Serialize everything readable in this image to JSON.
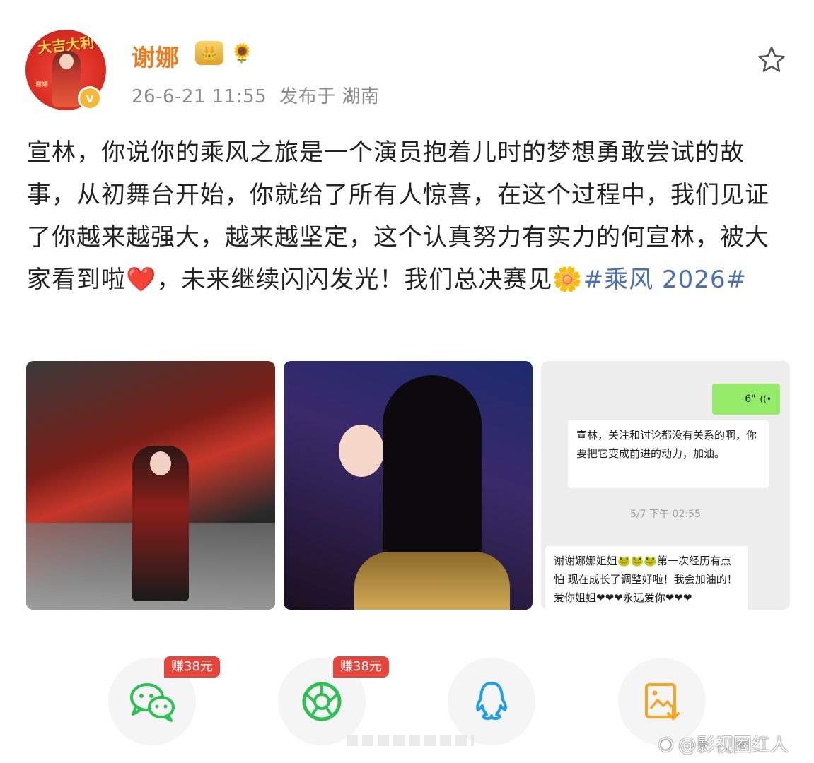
{
  "post": {
    "author": "谢娜",
    "verified_mark": "v",
    "avatar_caption": "大吉大利",
    "avatar_seal": "谢娜",
    "date": "26-6-21 11:55",
    "location": "发布于 湖南",
    "text_part1": "宣林，你说你的乘风之旅是一个演员抱着儿时的梦想勇敢尝试的故事，从初舞台开始，你就给了所有人惊喜，在这个过程中，我们见证了你越来越强大，越来越坚定，这个认真努力有实力的何宣林，被大家看到啦",
    "heart_emoji": "❤️",
    "text_part2": "，未来继续闪闪发光！我们总决赛见",
    "sun_emoji": "🌼",
    "hashtag": "#乘风 2026#"
  },
  "chat": {
    "sent_voice": "6\"",
    "recv_1": "宣林，关注和讨论都没有关系的啊，你要把它变成前进的动力，加油。",
    "time": "5/7 下午 02:55",
    "recv_2": "谢谢娜娜姐姐🐸🐸🐸第一次经历有点怕 现在成长了调整好啦！我会加油的！爱你姐姐❤❤❤永远爱你❤❤❤"
  },
  "share": {
    "reward_1": "赚38元",
    "reward_2": "赚38元",
    "items": [
      "wechat-icon",
      "moments-icon",
      "qq-icon",
      "save-image-icon"
    ]
  },
  "watermark": "@影视圈红人",
  "colors": {
    "username": "#ee7a1e",
    "hashtag": "#4a6fb5",
    "reward": "#e9443a",
    "wechat_green": "#2cc153",
    "qq_blue": "#1ea0f0",
    "save_orange": "#f5a623"
  }
}
